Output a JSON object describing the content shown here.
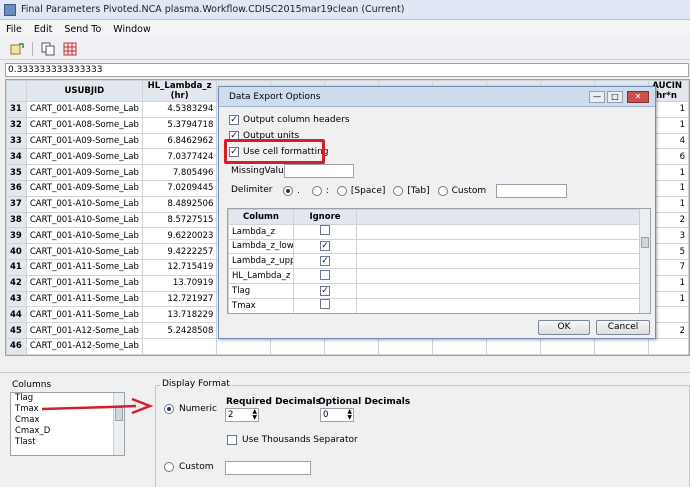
{
  "window": {
    "title": "Final Parameters Pivoted.NCA plasma.Workflow.CDISC2015mar19clean (Current)"
  },
  "menu": [
    "File",
    "Edit",
    "Send To",
    "Window"
  ],
  "formula_bar": {
    "value": "0.333333333333333"
  },
  "grid": {
    "headers": [
      "USUBJID",
      "HL_Lambda_z\n(hr)",
      "",
      "",
      "",
      "",
      "",
      "",
      "",
      "",
      "",
      "AUCIN\n(hr*n"
    ],
    "rows": [
      {
        "num": "31",
        "usubjid": "CART_001-A08-Some_Lab",
        "hl": "4.5383294",
        "auc": "1"
      },
      {
        "num": "32",
        "usubjid": "CART_001-A08-Some_Lab",
        "hl": "5.3794718",
        "auc": "1"
      },
      {
        "num": "33",
        "usubjid": "CART_001-A09-Some_Lab",
        "hl": "6.8462962",
        "auc": "4"
      },
      {
        "num": "34",
        "usubjid": "CART_001-A09-Some_Lab",
        "hl": "7.0377424",
        "auc": "6"
      },
      {
        "num": "35",
        "usubjid": "CART_001-A09-Some_Lab",
        "hl": "7.805496",
        "auc": "1"
      },
      {
        "num": "36",
        "usubjid": "CART_001-A09-Some_Lab",
        "hl": "7.0209445",
        "auc": "1"
      },
      {
        "num": "37",
        "usubjid": "CART_001-A10-Some_Lab",
        "hl": "8.4892506",
        "auc": "1"
      },
      {
        "num": "38",
        "usubjid": "CART_001-A10-Some_Lab",
        "hl": "8.5727515",
        "auc": "2"
      },
      {
        "num": "39",
        "usubjid": "CART_001-A10-Some_Lab",
        "hl": "9.6220023",
        "auc": "3"
      },
      {
        "num": "40",
        "usubjid": "CART_001-A10-Some_Lab",
        "hl": "9.4222257",
        "auc": "5"
      },
      {
        "num": "41",
        "usubjid": "CART_001-A11-Some_Lab",
        "hl": "12.715419",
        "auc": "7"
      },
      {
        "num": "42",
        "usubjid": "CART_001-A11-Some_Lab",
        "hl": "13.70919",
        "auc": "1"
      },
      {
        "num": "43",
        "usubjid": "CART_001-A11-Some_Lab",
        "hl": "12.721927",
        "auc": "1"
      },
      {
        "num": "44",
        "usubjid": "CART_001-A11-Some_Lab",
        "hl": "13.718229",
        "auc": ""
      },
      {
        "num": "45",
        "usubjid": "CART_001-A12-Some_Lab",
        "hl": "5.2428508",
        "auc": "2"
      },
      {
        "num": "46",
        "usubjid": "CART_001-A12-Some_Lab",
        "hl": "",
        "auc": ""
      }
    ]
  },
  "bottom": {
    "columns_label": "Columns",
    "columns": [
      "Tlag",
      "Tmax",
      "Cmax",
      "Cmax_D",
      "Tlast"
    ],
    "display_format_label": "Display Format",
    "numeric_label": "Numeric",
    "custom_label": "Custom",
    "required_decimals_label": "Required Decimals",
    "required_decimals_value": "2",
    "optional_decimals_label": "Optional Decimals",
    "optional_decimals_value": "0",
    "thousands_label": "Use Thousands Separator"
  },
  "dialog": {
    "title": "Data Export Options",
    "output_headers": "Output column headers",
    "output_units": "Output units",
    "use_cell_formatting": "Use cell formatting",
    "missing_value_label": "MissingValue",
    "delimiter_label": "Delimiter",
    "delims": [
      ".",
      ":",
      "[Space]",
      "[Tab]",
      "Custom"
    ],
    "col_header": "Column",
    "ignore_header": "Ignore",
    "rows": [
      {
        "column": "Lambda_z",
        "ignore": false
      },
      {
        "column": "Lambda_z_lowe",
        "ignore": true
      },
      {
        "column": "Lambda_z_uppe",
        "ignore": true
      },
      {
        "column": "HL_Lambda_z",
        "ignore": false
      },
      {
        "column": "Tlag",
        "ignore": true
      },
      {
        "column": "Tmax",
        "ignore": false
      }
    ],
    "ok": "OK",
    "cancel": "Cancel"
  },
  "colors": {
    "annotation": "#d21f2b",
    "title_bar": "#dfe8f4"
  }
}
